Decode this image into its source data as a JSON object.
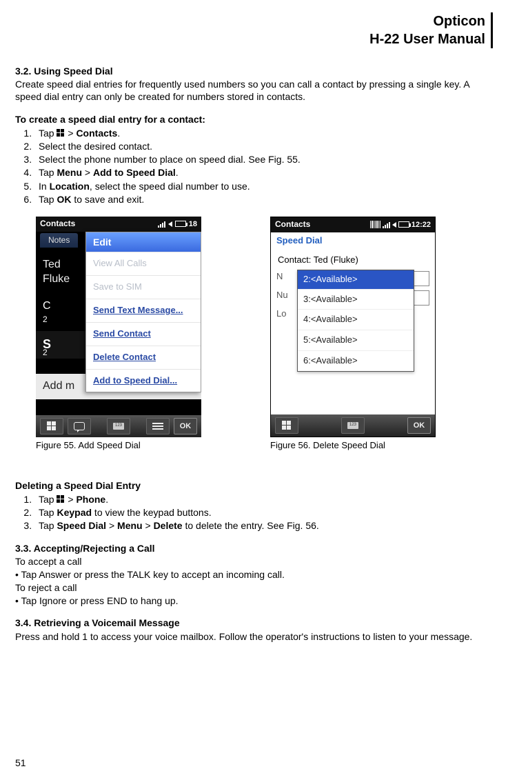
{
  "header": {
    "line1": "Opticon",
    "line2": "H-22 User Manual"
  },
  "sec32": {
    "num_title": "3.2.   Using Speed Dial",
    "intro": "Create speed dial entries for frequently used numbers so you can call a contact by pressing a single key. A speed dial entry can only be created for numbers stored in contacts.",
    "create_h": "To create a speed dial entry for a contact:",
    "steps": {
      "s1a": "Tap ",
      "s1b": "  > ",
      "s1c": "Contacts",
      "s1d": ".",
      "s2": "Select the desired contact.",
      "s3": "Select the phone number to place on speed dial. See Fig. 55.",
      "s4a": "Tap ",
      "s4b": "Menu",
      "s4c": " > ",
      "s4d": "Add to Speed Dial",
      "s4e": ".",
      "s5a": "In ",
      "s5b": "Location",
      "s5c": ", select the speed dial number to use.",
      "s6a": "Tap ",
      "s6b": "OK",
      "s6c": " to save and exit."
    }
  },
  "fig55": {
    "caption": "Figure 55. Add Speed Dial"
  },
  "fig56": {
    "caption": "Figure 56. Delete Speed Dial"
  },
  "shot1": {
    "title": "Contacts",
    "time": "18",
    "notes_tab": "Notes",
    "contact_first": "Ted",
    "contact_last": "Fluke",
    "row_c": "C",
    "row_c_n": "2",
    "row_s": "S",
    "row_s_n": "2",
    "addme": "Add m",
    "menu": {
      "header": "Edit",
      "view_all": "View All Calls",
      "save_sim": "Save to SIM",
      "send_text": "Send Text Message...",
      "send_contact": "Send Contact",
      "delete": "Delete Contact",
      "add_sd": "Add to Speed Dial..."
    },
    "ok": "OK",
    "kbd": "123"
  },
  "shot2": {
    "title": "Contacts",
    "time": "12:22",
    "sub": "Speed Dial",
    "contact_line": "Contact:  Ted (Fluke)",
    "labels": {
      "l1": "N",
      "l2": "Nu",
      "l3": "Lo"
    },
    "options": {
      "o2": "2:<Available>",
      "o3": "3:<Available>",
      "o4": "4:<Available>",
      "o5": "5:<Available>",
      "o6": "6:<Available>"
    },
    "ok": "OK",
    "kbd": "123"
  },
  "deleting": {
    "h": "Deleting a Speed Dial Entry",
    "s1a": "Tap ",
    "s1b": "  > ",
    "s1c": "Phone",
    "s1d": ".",
    "s2a": "Tap ",
    "s2b": "Keypad",
    "s2c": " to view the keypad buttons.",
    "s3a": "Tap ",
    "s3b": "Speed Dial",
    "s3c": " > ",
    "s3d": "Menu",
    "s3e": " > ",
    "s3f": "Delete",
    "s3g": " to delete the entry. See Fig. 56."
  },
  "sec33": {
    "num_title": "3.3.   Accepting/Rejecting a Call",
    "l1": "To accept a call",
    "l2": "• Tap Answer or press the TALK key to accept an incoming call.",
    "l3": "To reject a call",
    "l4": "• Tap Ignore or press END to hang up."
  },
  "sec34": {
    "num_title": "3.4.   Retrieving a Voicemail Message",
    "body": "Press and hold 1 to access your voice mailbox. Follow the operator's instructions to listen to your message."
  },
  "page_number": "51"
}
